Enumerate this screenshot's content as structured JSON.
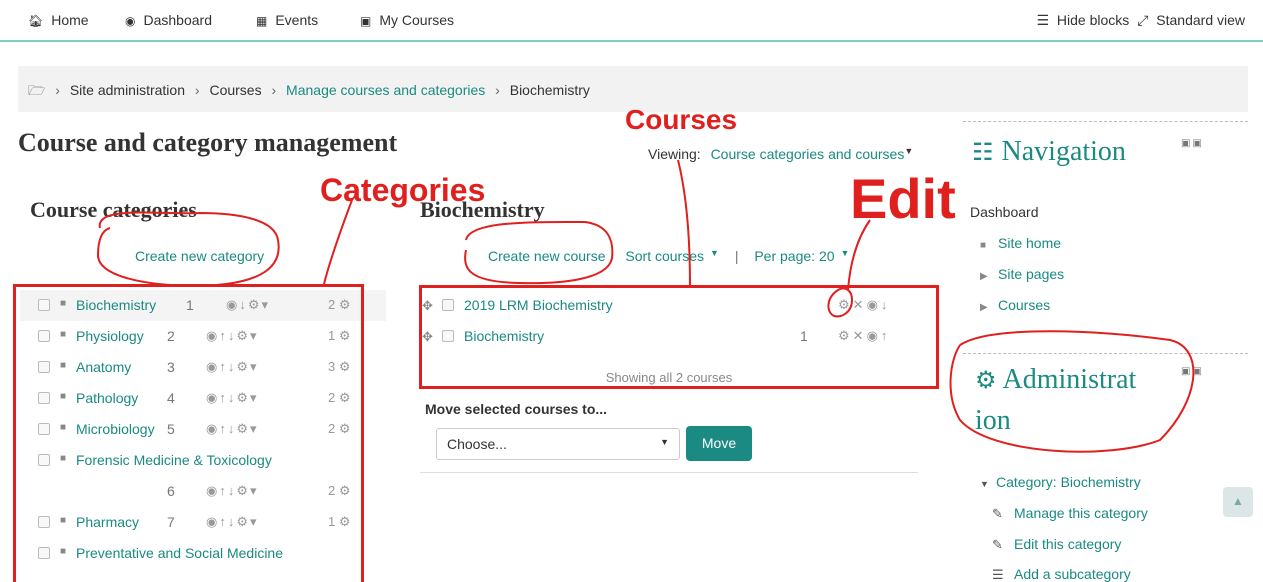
{
  "navbar": {
    "home": "Home",
    "dashboard": "Dashboard",
    "events": "Events",
    "my_courses": "My Courses",
    "hide_blocks": "Hide blocks",
    "standard_view": "Standard view"
  },
  "breadcrumb": {
    "items": [
      "Site administration",
      "Courses",
      "Manage courses and categories",
      "Biochemistry"
    ]
  },
  "page": {
    "title": "Course and category management",
    "viewing_label": "Viewing:",
    "viewing_value": "Course categories and courses"
  },
  "categories": {
    "heading": "Course categories",
    "create_label": "Create new category",
    "items": [
      {
        "name": "Biochemistry",
        "index": "1",
        "count": "2"
      },
      {
        "name": "Physiology",
        "index": "2",
        "count": "1"
      },
      {
        "name": "Anatomy",
        "index": "3",
        "count": "3"
      },
      {
        "name": "Pathology",
        "index": "4",
        "count": "2"
      },
      {
        "name": "Microbiology",
        "index": "5",
        "count": "2"
      },
      {
        "name": "Forensic Medicine & Toxicology",
        "index": "6",
        "count": "2"
      },
      {
        "name": "Pharmacy",
        "index": "7",
        "count": "1"
      },
      {
        "name": "Preventative and Social Medicine",
        "index": "",
        "count": ""
      }
    ]
  },
  "courses": {
    "heading": "Biochemistry",
    "create_label": "Create new course",
    "sort_label": "Sort courses",
    "separator": "|",
    "per_page_label": "Per page: 20",
    "items": [
      {
        "name": "2019 LRM Biochemistry",
        "number": ""
      },
      {
        "name": "Biochemistry",
        "number": "1"
      }
    ],
    "showing_text": "Showing all 2 courses",
    "move_label": "Move selected courses to...",
    "select_placeholder": "Choose...",
    "move_button": "Move"
  },
  "blocks": {
    "navigation": {
      "title": "Navigation",
      "items": [
        "Dashboard",
        "Site home",
        "Site pages",
        "Courses"
      ]
    },
    "administration": {
      "title_line1": "Administrat",
      "title_line2": "ion",
      "category_label": "Category: Biochemistry",
      "items": [
        "Manage this category",
        "Edit this category",
        "Add a subcategory"
      ]
    }
  },
  "annotations": {
    "courses": "Courses",
    "categories": "Categories",
    "edit": "Edit"
  },
  "colors": {
    "accent": "#1a8a82",
    "annotation": "#e0201e"
  }
}
